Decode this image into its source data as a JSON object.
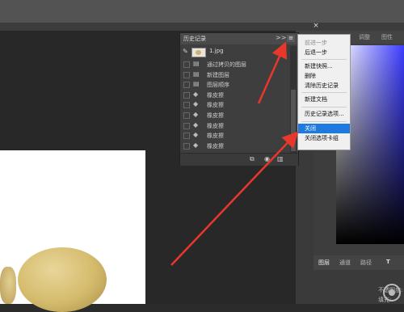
{
  "window": {
    "tab_close": "×"
  },
  "dock": {
    "tabs": [
      "调整",
      "图性"
    ]
  },
  "history": {
    "title": "历史记录",
    "expand": ">>",
    "menu_icon": "≡",
    "snapshot": "1.jpg",
    "items": [
      {
        "label": "通过拷贝的图层",
        "icon": "layer"
      },
      {
        "label": "新建图层",
        "icon": "layer"
      },
      {
        "label": "图层顺序",
        "icon": "layer"
      },
      {
        "label": "橡皮擦",
        "icon": "eraser"
      },
      {
        "label": "橡皮擦",
        "icon": "eraser"
      },
      {
        "label": "橡皮擦",
        "icon": "eraser"
      },
      {
        "label": "橡皮擦",
        "icon": "eraser"
      },
      {
        "label": "橡皮擦",
        "icon": "eraser"
      },
      {
        "label": "橡皮擦",
        "icon": "eraser"
      }
    ]
  },
  "menu": {
    "items": [
      {
        "label": "前进一步",
        "disabled": true
      },
      {
        "label": "后退一步",
        "disabled": false
      },
      {
        "label": "新建快照...",
        "disabled": false
      },
      {
        "label": "删除",
        "disabled": false
      },
      {
        "label": "清除历史记录",
        "disabled": false
      },
      {
        "label": "新建文档",
        "disabled": false
      },
      {
        "label": "历史记录选项...",
        "disabled": false
      },
      {
        "label": "关闭",
        "disabled": false,
        "active": true
      },
      {
        "label": "关闭选项卡组",
        "disabled": false
      }
    ]
  },
  "layers": {
    "tabs": [
      "图层",
      "通道",
      "路径"
    ],
    "opacity_label": "不透明度:",
    "fill_label": "填充:"
  },
  "colors": {
    "accent": "#1f7ae0",
    "arrow": "#e8372b"
  }
}
